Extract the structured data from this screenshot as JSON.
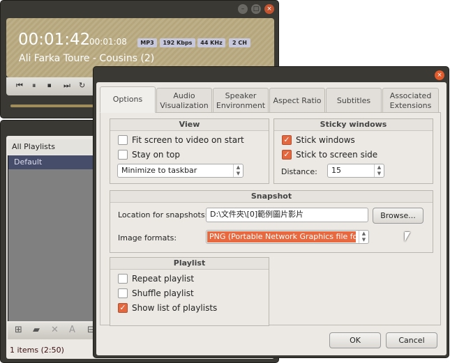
{
  "player": {
    "elapsed": "00:01:42",
    "remaining": "00:01:08",
    "badges": [
      "MP3",
      "192 Kbps",
      "44 KHz",
      "2 CH"
    ],
    "track": "Ali Farka Toure - Cousins (2)",
    "progress": 0.6
  },
  "playlist": {
    "header": "All Playlists",
    "items": [
      "Default"
    ],
    "status": "1 items (2:50)"
  },
  "dialog": {
    "tabs": [
      {
        "label": "Options"
      },
      {
        "label": "Audio Visualization"
      },
      {
        "label": "Speaker Environment"
      },
      {
        "label": "Aspect Ratio"
      },
      {
        "label": "Subtitles"
      },
      {
        "label": "Associated Extensions"
      }
    ],
    "view": {
      "title": "View",
      "fit": "Fit screen to video on start",
      "fit_checked": false,
      "top": "Stay on top",
      "top_checked": false,
      "minimize": "Minimize to taskbar"
    },
    "sticky": {
      "title": "Sticky windows",
      "stick": "Stick windows",
      "stick_checked": true,
      "side": "Stick to screen side",
      "side_checked": true,
      "distance_label": "Distance:",
      "distance": "15"
    },
    "snapshot": {
      "title": "Snapshot",
      "location_label": "Location for snapshots:",
      "location": "D:\\文件夾\\[0]範例圖片影片",
      "browse": "Browse...",
      "format_label": "Image formats:",
      "format": "PNG (Portable Network Graphics file format)"
    },
    "playlist": {
      "title": "Playlist",
      "repeat": "Repeat playlist",
      "repeat_checked": false,
      "shuffle": "Shuffle playlist",
      "shuffle_checked": false,
      "show": "Show list of playlists",
      "show_checked": true
    },
    "ok": "OK",
    "cancel": "Cancel"
  },
  "colors": {
    "accent": "#e3683f",
    "selection": "#454d6a"
  }
}
